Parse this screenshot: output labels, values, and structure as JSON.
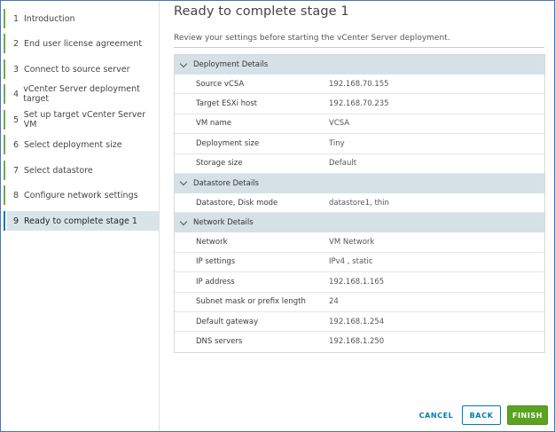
{
  "steps": [
    {
      "num": "1",
      "label": "Introduction"
    },
    {
      "num": "2",
      "label": "End user license agreement"
    },
    {
      "num": "3",
      "label": "Connect to source server"
    },
    {
      "num": "4",
      "label": "vCenter Server deployment target"
    },
    {
      "num": "5",
      "label": "Set up target vCenter Server VM"
    },
    {
      "num": "6",
      "label": "Select deployment size"
    },
    {
      "num": "7",
      "label": "Select datastore"
    },
    {
      "num": "8",
      "label": "Configure network settings"
    },
    {
      "num": "9",
      "label": "Ready to complete stage 1"
    }
  ],
  "page": {
    "title": "Ready to complete stage 1",
    "subtitle": "Review your settings before starting the vCenter Server deployment."
  },
  "sections": {
    "deployment": {
      "title": "Deployment Details",
      "rows": [
        {
          "label": "Source vCSA",
          "value": "192.168.70.155"
        },
        {
          "label": "Target ESXi host",
          "value": "192.168.70.235"
        },
        {
          "label": "VM name",
          "value": "VCSA"
        },
        {
          "label": "Deployment size",
          "value": "Tiny"
        },
        {
          "label": "Storage size",
          "value": "Default"
        }
      ]
    },
    "datastore": {
      "title": "Datastore Details",
      "rows": [
        {
          "label": "Datastore, Disk mode",
          "value": "datastore1, thin"
        }
      ]
    },
    "network": {
      "title": "Network Details",
      "rows": [
        {
          "label": "Network",
          "value": "VM Network"
        },
        {
          "label": "IP settings",
          "value": "IPv4 , static"
        },
        {
          "label": "IP address",
          "value": "192.168.1.165"
        },
        {
          "label": "Subnet mask or prefix length",
          "value": "24"
        },
        {
          "label": "Default gateway",
          "value": "192.168.1.254"
        },
        {
          "label": "DNS servers",
          "value": "192.168.1.250"
        }
      ]
    }
  },
  "buttons": {
    "cancel": "CANCEL",
    "back": "BACK",
    "finish": "FINISH"
  },
  "colors": {
    "completed_step": "#6ab04c",
    "active_step_bg": "#d9e4ea",
    "primary": "#0079b8",
    "finish": "#5aa220"
  }
}
